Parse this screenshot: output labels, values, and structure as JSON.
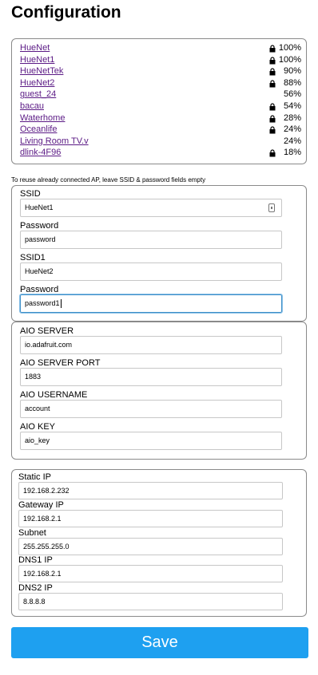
{
  "title": "Configuration",
  "networks": [
    {
      "ssid": "HueNet",
      "secure": true,
      "quality": "100%"
    },
    {
      "ssid": "HueNet1",
      "secure": true,
      "quality": "100%"
    },
    {
      "ssid": "HueNetTek",
      "secure": true,
      "quality": "90%"
    },
    {
      "ssid": "HueNet2",
      "secure": true,
      "quality": "88%"
    },
    {
      "ssid": "guest_24",
      "secure": false,
      "quality": "56%"
    },
    {
      "ssid": "bacau",
      "secure": true,
      "quality": "54%"
    },
    {
      "ssid": "Waterhome",
      "secure": true,
      "quality": "28%"
    },
    {
      "ssid": "Oceanlife",
      "secure": true,
      "quality": "24%"
    },
    {
      "ssid": "Living Room TV.v",
      "secure": false,
      "quality": "24%"
    },
    {
      "ssid": "dlink-4F96",
      "secure": true,
      "quality": "18%"
    }
  ],
  "hint": "To reuse already connected AP, leave SSID & password fields empty",
  "wifi": {
    "ssid_label": "SSID",
    "ssid_value": "HueNet1",
    "password_label": "Password",
    "password_value": "password",
    "ssid1_label": "SSID1",
    "ssid1_value": "HueNet2",
    "password1_label": "Password",
    "password1_value": "password1"
  },
  "aio": {
    "server_label": "AIO SERVER",
    "server_value": "io.adafruit.com",
    "port_label": "AIO SERVER PORT",
    "port_value": "1883",
    "username_label": "AIO USERNAME",
    "username_value": "account",
    "key_label": "AIO KEY",
    "key_value": "aio_key"
  },
  "ip": {
    "static_label": "Static IP",
    "static_value": "192.168.2.232",
    "gateway_label": "Gateway IP",
    "gateway_value": "192.168.2.1",
    "subnet_label": "Subnet",
    "subnet_value": "255.255.255.0",
    "dns1_label": "DNS1 IP",
    "dns1_value": "192.168.2.1",
    "dns2_label": "DNS2 IP",
    "dns2_value": "8.8.8.8"
  },
  "save_label": "Save",
  "colors": {
    "link": "#5b1a85",
    "save_button": "#1ea0f0",
    "focus_border": "#3e8fc8"
  }
}
